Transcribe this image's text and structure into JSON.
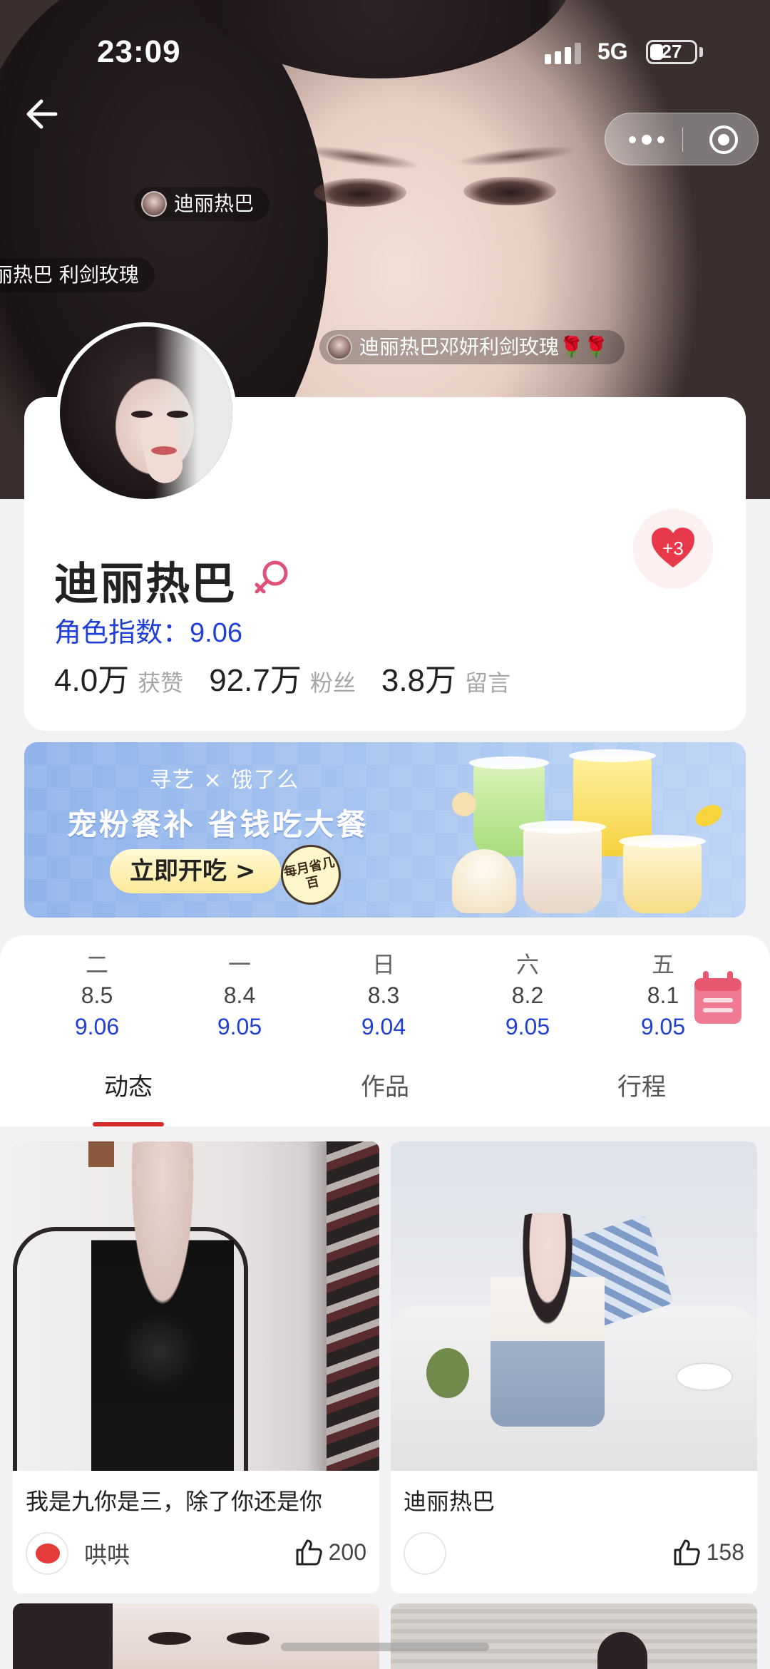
{
  "status_bar": {
    "time": "23:09",
    "network": "5G",
    "battery": "27",
    "battery_level": 0.27
  },
  "barrages": [
    {
      "text": "迪丽热巴"
    },
    {
      "text": "丽热巴  利剑玫瑰"
    },
    {
      "text": "迪丽热巴邓妍利剑玫瑰🌹🌹"
    }
  ],
  "profile": {
    "name": "迪丽热巴",
    "index_label": "角色指数：",
    "index_value": "9.06",
    "like_badge": "+3",
    "stats": [
      {
        "value": "4.0万",
        "label": "获赞"
      },
      {
        "value": "92.7万",
        "label": "粉丝"
      },
      {
        "value": "3.8万",
        "label": "留言"
      }
    ]
  },
  "banner": {
    "brand": "寻艺 × 饿了么",
    "headline": "宠粉餐补 省钱吃大餐",
    "cta": "立即开吃 >",
    "sticker": "每月省几百"
  },
  "days": [
    {
      "weekday": "二",
      "date": "8.5",
      "score": "9.06"
    },
    {
      "weekday": "一",
      "date": "8.4",
      "score": "9.05"
    },
    {
      "weekday": "日",
      "date": "8.3",
      "score": "9.04"
    },
    {
      "weekday": "六",
      "date": "8.2",
      "score": "9.05"
    },
    {
      "weekday": "五",
      "date": "8.1",
      "score": "9.05"
    }
  ],
  "tabs": [
    {
      "label": "动态"
    },
    {
      "label": "作品"
    },
    {
      "label": "行程"
    }
  ],
  "feed": [
    {
      "title": "我是九你是三，除了你还是你",
      "user": "哄哄",
      "likes": "200"
    },
    {
      "title": "迪丽热巴",
      "user": "",
      "likes": "158"
    }
  ],
  "colors": {
    "accent_red": "#d62b2b",
    "index_blue": "#1f3fd6",
    "heart": "#e8394a",
    "gender": "#e0517a"
  }
}
